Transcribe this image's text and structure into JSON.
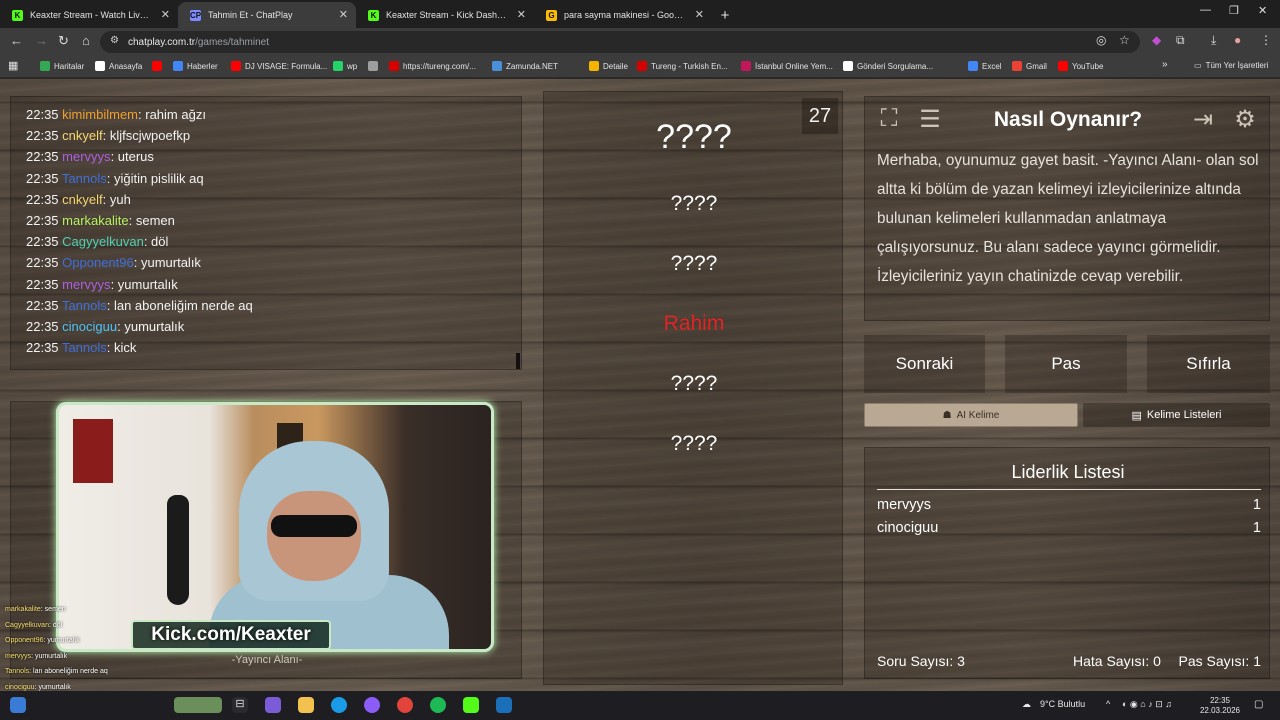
{
  "browser": {
    "tabs": [
      {
        "label": "Keaxter Stream - Watch Live on",
        "fav": "K",
        "fav_color": "#53fc18",
        "active": false
      },
      {
        "label": "Tahmin Et - ChatPlay",
        "fav": "CP",
        "fav_color": "#7c8cff",
        "active": true
      },
      {
        "label": "Keaxter Stream - Kick Dashboar",
        "fav": "K",
        "fav_color": "#53fc18",
        "active": false
      },
      {
        "label": "para sayma makinesi - Google A",
        "fav": "G",
        "fav_color": "#fbbc05",
        "active": false
      }
    ],
    "url_host": "chatplay.com.tr",
    "url_path": "/games/tahminet",
    "bookmarks": [
      {
        "label": "Haritalar",
        "color": "#34a853"
      },
      {
        "label": "Anasayfa",
        "color": "#ffffff"
      },
      {
        "label": "",
        "color": "#ff0000"
      },
      {
        "label": "Haberler",
        "color": "#4285f4"
      },
      {
        "label": "DJ VISAGE: Formula...",
        "color": "#ff0000"
      },
      {
        "label": "wp",
        "color": "#25d366"
      },
      {
        "label": "",
        "color": "#9e9e9e"
      },
      {
        "label": "https://tureng.com/...",
        "color": "#d50000"
      },
      {
        "label": "Zamunda.NET",
        "color": "#4a90d9"
      },
      {
        "label": "Detaile",
        "color": "#f4b400"
      },
      {
        "label": "Tureng - Turkish En...",
        "color": "#d50000"
      },
      {
        "label": "İstanbul Online Yem...",
        "color": "#c2185b"
      },
      {
        "label": "Gönderi Sorgulama...",
        "color": "#ffffff"
      },
      {
        "label": "Excel",
        "color": "#4285f4"
      },
      {
        "label": "Gmail",
        "color": "#ea4335"
      },
      {
        "label": "YouTube",
        "color": "#ff0000"
      }
    ],
    "all_bookmarks": "Tüm Yer İşaretleri"
  },
  "chat": [
    {
      "time": "22:35",
      "user": "kimimbilmem",
      "color": "#f0a030",
      "msg": ": rahim ağzı"
    },
    {
      "time": "22:35",
      "user": "cnkyelf",
      "color": "#f5d76e",
      "msg": ": kljfscjwpoefkp"
    },
    {
      "time": "22:35",
      "user": "mervyys",
      "color": "#b060e0",
      "msg": ": uterus"
    },
    {
      "time": "22:35",
      "user": "Tannols",
      "color": "#3f6fd8",
      "msg": ": yiğitin pislilik aq"
    },
    {
      "time": "22:35",
      "user": "cnkyelf",
      "color": "#f5d76e",
      "msg": ": yuh"
    },
    {
      "time": "22:35",
      "user": "markakalite",
      "color": "#b8f060",
      "msg": ": semen"
    },
    {
      "time": "22:35",
      "user": "Cagyyelkuvan",
      "color": "#4fd0b0",
      "msg": ": döl"
    },
    {
      "time": "22:35",
      "user": "Opponent96",
      "color": "#3f6fd8",
      "msg": ": yumurtalık"
    },
    {
      "time": "22:35",
      "user": "mervyys",
      "color": "#b060e0",
      "msg": ": yumurtalık"
    },
    {
      "time": "22:35",
      "user": "Tannols",
      "color": "#3f6fd8",
      "msg": ": lan aboneliğim nerde aq"
    },
    {
      "time": "22:35",
      "user": "cinociguu",
      "color": "#4fc3f7",
      "msg": ": yumurtalık"
    },
    {
      "time": "22:35",
      "user": "Tannols",
      "color": "#3f6fd8",
      "msg": ": kick"
    }
  ],
  "camera": {
    "brand": "Kick.com/Keaxter",
    "area_label": "-Yayıncı Alanı-",
    "mini_chat": [
      {
        "user": "markakalite",
        "msg": ": semen"
      },
      {
        "user": "Cagyyelkuvan",
        "msg": ": döl"
      },
      {
        "user": "Opponent96",
        "msg": ": yumurtalık"
      },
      {
        "user": "mervyys",
        "msg": ": yumurtalık"
      },
      {
        "user": "Tannols",
        "msg": ": lan aboneliğim nerde aq"
      },
      {
        "user": "cinociguu",
        "msg": ": yumurtalık"
      },
      {
        "user": "Tannols",
        "msg": ": kick"
      }
    ]
  },
  "game": {
    "counter": "27",
    "words": [
      "????",
      "????",
      "????",
      "Rahim",
      "????",
      "????"
    ],
    "revealed_color": "#e02424"
  },
  "info": {
    "title": "Nasıl Oynanır?",
    "text": "Merhaba, oyunumuz gayet basit. -Yayıncı Alanı- olan sol altta ki bölüm de yazan kelimeyi izleyicilerinize altında bulunan kelimeleri kullanmadan anlatmaya çalışıyorsunuz. Bu alanı sadece yayıncı görmelidir. İzleyicileriniz yayın chatinizde cevap verebilir."
  },
  "controls": {
    "next": "Sonraki",
    "pass": "Pas",
    "reset": "Sıfırla",
    "ai_word": "AI Kelime",
    "word_lists": "Kelime Listeleri"
  },
  "leaderboard": {
    "title": "Liderlik Listesi",
    "rows": [
      {
        "name": "mervyys",
        "score": "1"
      },
      {
        "name": "cinociguu",
        "score": "1"
      }
    ],
    "question_count": "Soru Sayısı: 3",
    "error_count": "Hata Sayısı: 0",
    "pass_count": "Pas Sayısı: 1"
  },
  "taskbar": {
    "weather": "9°C  Bulutlu",
    "time": "22:35",
    "date": "22.03.2026"
  }
}
